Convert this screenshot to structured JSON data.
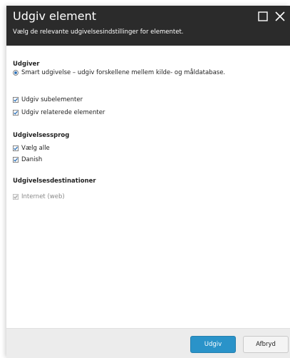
{
  "dialog": {
    "title": "Udgiv element",
    "subtitle": "Vælg de relevante udgivelsesindstillinger for elementet.",
    "maximize_icon": "square-maximize-icon",
    "close_icon": "x-close-icon"
  },
  "publisher": {
    "heading": "Udgiver",
    "smart_publish_label": "Smart udgivelse – udgiv forskellene mellem kilde- og måldatabase.",
    "smart_publish_selected": true,
    "subitems_label": "Udgiv subelementer",
    "subitems_checked": true,
    "related_label": "Udgiv relaterede elementer",
    "related_checked": true
  },
  "languages": {
    "heading": "Udgivelsessprog",
    "select_all_label": "Vælg alle",
    "select_all_checked": true,
    "items": [
      {
        "label": "Danish",
        "checked": true
      }
    ]
  },
  "targets": {
    "heading": "Udgivelsesdestinationer",
    "items": [
      {
        "label": "Internet (web)",
        "checked": true,
        "disabled": true
      }
    ]
  },
  "footer": {
    "publish_label": "Udgiv",
    "cancel_label": "Afbryd"
  },
  "colors": {
    "header_bg": "#2b2b2b",
    "primary": "#2a93c9",
    "checkbox_accent": "#2a6fb7"
  }
}
